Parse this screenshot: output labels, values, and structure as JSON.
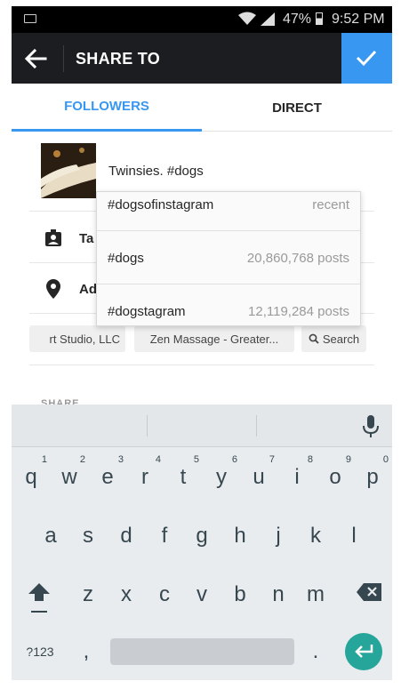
{
  "status_bar": {
    "battery_percent": "47%",
    "time": "9:52 PM"
  },
  "header": {
    "title": "SHARE TO"
  },
  "tabs": [
    {
      "label": "FOLLOWERS"
    },
    {
      "label": "DIRECT"
    }
  ],
  "caption": "Twinsies. #dogs",
  "rows": {
    "tag_people_partial": "Ta",
    "add_location_partial": "Ad"
  },
  "location_chips": [
    {
      "label": "rt Studio, LLC"
    },
    {
      "label": "Zen Massage - Greater..."
    },
    {
      "label": "Search"
    }
  ],
  "share_section_partial": "SHARE",
  "hashtag_suggestions": [
    {
      "tag": "#dogsofinstagram",
      "meta": "recent"
    },
    {
      "tag": "#dogs",
      "meta": "20,860,768 posts"
    },
    {
      "tag": "#dogstagram",
      "meta": "12,119,284 posts"
    }
  ],
  "keyboard": {
    "row1": [
      {
        "key": "q",
        "hint": "1"
      },
      {
        "key": "w",
        "hint": "2"
      },
      {
        "key": "e",
        "hint": "3"
      },
      {
        "key": "r",
        "hint": "4"
      },
      {
        "key": "t",
        "hint": "5"
      },
      {
        "key": "y",
        "hint": "6"
      },
      {
        "key": "u",
        "hint": "7"
      },
      {
        "key": "i",
        "hint": "8"
      },
      {
        "key": "o",
        "hint": "9"
      },
      {
        "key": "p",
        "hint": "0"
      }
    ],
    "row2": [
      "a",
      "s",
      "d",
      "f",
      "g",
      "h",
      "j",
      "k",
      "l"
    ],
    "row3": [
      "z",
      "x",
      "c",
      "v",
      "b",
      "n",
      "m"
    ],
    "symbols_key": "?123",
    "comma_key": ",",
    "period_key": "."
  },
  "colors": {
    "accent": "#3897f0",
    "header_bg": "#1b1d20",
    "enter_key": "#26a69a"
  }
}
